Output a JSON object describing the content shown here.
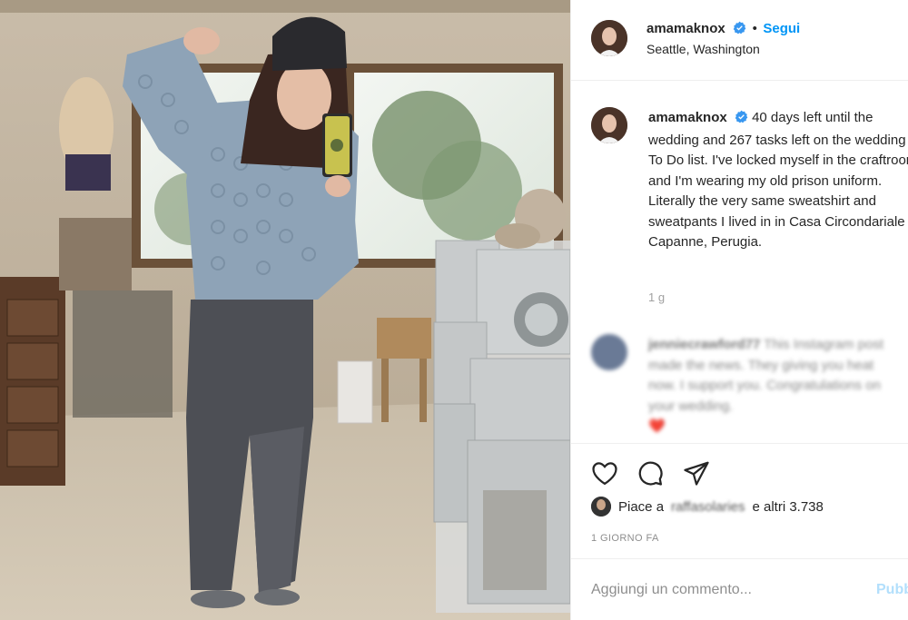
{
  "post": {
    "username": "amamaknox",
    "follow_label": "Segui",
    "dot": "•",
    "location": "Seattle, Washington"
  },
  "caption": {
    "username": "amamaknox",
    "text": "40 days left until the wedding and 267 tasks left on the wedding To Do list. I've locked myself in the craftroom and I'm wearing my old prison uniform. Literally the very same sweatshirt and sweatpants I lived in in Casa Circondariale Capanne, Perugia.",
    "time": "1 g"
  },
  "comment": {
    "username": "jenniecrawford77",
    "text": "This Instagram post made the news. They giving you heat now. I support you. Congratulations on your wedding.",
    "emoji": "❤️"
  },
  "likes": {
    "prefix": "Piace a",
    "user": "raffasolaries",
    "suffix": "e altri 3.738"
  },
  "date": "1 GIORNO FA",
  "add_comment": {
    "placeholder": "Aggiungi un commento...",
    "publish": "Pubblica"
  },
  "colors": {
    "accent": "#0095f6",
    "verified": "#3897f0",
    "heart": "#ed4956"
  },
  "icons": [
    "verified-badge-icon",
    "heart-icon",
    "comment-icon",
    "share-icon"
  ]
}
